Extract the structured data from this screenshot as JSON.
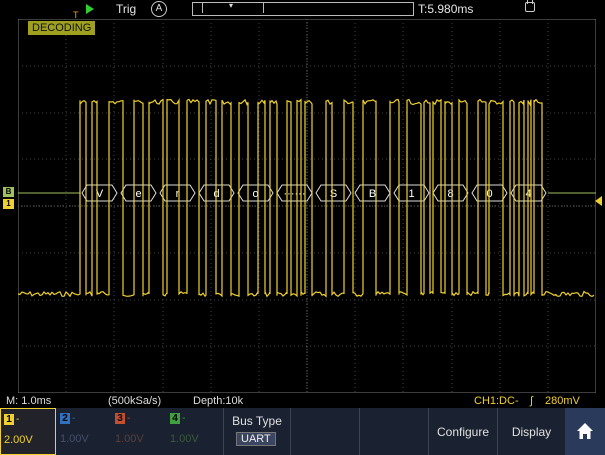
{
  "topbar": {
    "trigger_label": "Trig",
    "acquire_mode": "A",
    "trigger_marker": "T",
    "time_offset": "T:5.980ms",
    "run_state_color": "#2fd02f"
  },
  "screen": {
    "decoding_badge": "DECODING",
    "bus_marker": "B",
    "channel_marker": "1",
    "waveform_color": "#f0d030",
    "grid_color": "#555555",
    "decoded_symbols": [
      "V",
      "e",
      "r",
      "d",
      "o",
      "······",
      "S",
      "B",
      "1",
      "8",
      "0",
      "4"
    ]
  },
  "status": {
    "timebase": "M: 1.0ms",
    "sample_rate": "(500kSa/s)",
    "depth": "Depth:10k",
    "trigger_info": "CH1:DC-",
    "trigger_level": "280mV"
  },
  "channels": [
    {
      "id": "1",
      "label": "-",
      "volt": "2.00V",
      "color": "#f0d030",
      "active": true
    },
    {
      "id": "2",
      "label": "-",
      "volt": "1.00V",
      "color": "#3070c0",
      "active": false
    },
    {
      "id": "3",
      "label": "-",
      "volt": "1.00V",
      "color": "#c05030",
      "active": false
    },
    {
      "id": "4",
      "label": "-",
      "volt": "1.00V",
      "color": "#40a040",
      "active": false
    }
  ],
  "menu": {
    "bus_type_label": "Bus Type",
    "bus_type_value": "UART",
    "configure_label": "Configure",
    "display_label": "Display"
  }
}
